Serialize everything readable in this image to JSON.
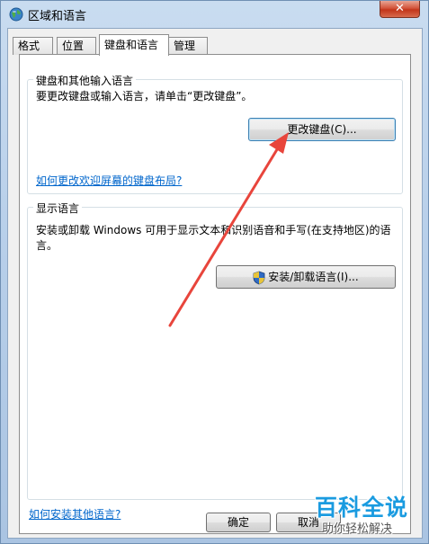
{
  "window": {
    "title": "区域和语言",
    "close_label": "✕"
  },
  "tabs": [
    {
      "label": "格式"
    },
    {
      "label": "位置"
    },
    {
      "label": "键盘和语言"
    },
    {
      "label": "管理"
    }
  ],
  "keyboard_group": {
    "label": "键盘和其他输入语言",
    "description": "要更改键盘或输入语言，请单击“更改键盘”。",
    "change_button": "更改键盘(C)...",
    "welcome_link": "如何更改欢迎屏幕的键盘布局?"
  },
  "display_group": {
    "label": "显示语言",
    "description_line1": "安装或卸载 Windows 可用于显示文本和识别语音和手写(在支持地区)的语",
    "description_line2": "言。",
    "install_button": "安装/卸载语言(I)..."
  },
  "bottom_link": "如何安装其他语言?",
  "footer": {
    "ok_button": "确定",
    "cancel_button": "取消"
  },
  "watermark": {
    "title": "百科全说",
    "subtitle": "助你轻松解决"
  },
  "colors": {
    "annotation_arrow": "#e8453c",
    "link": "#0066cc",
    "watermark": "#1a9be0"
  }
}
